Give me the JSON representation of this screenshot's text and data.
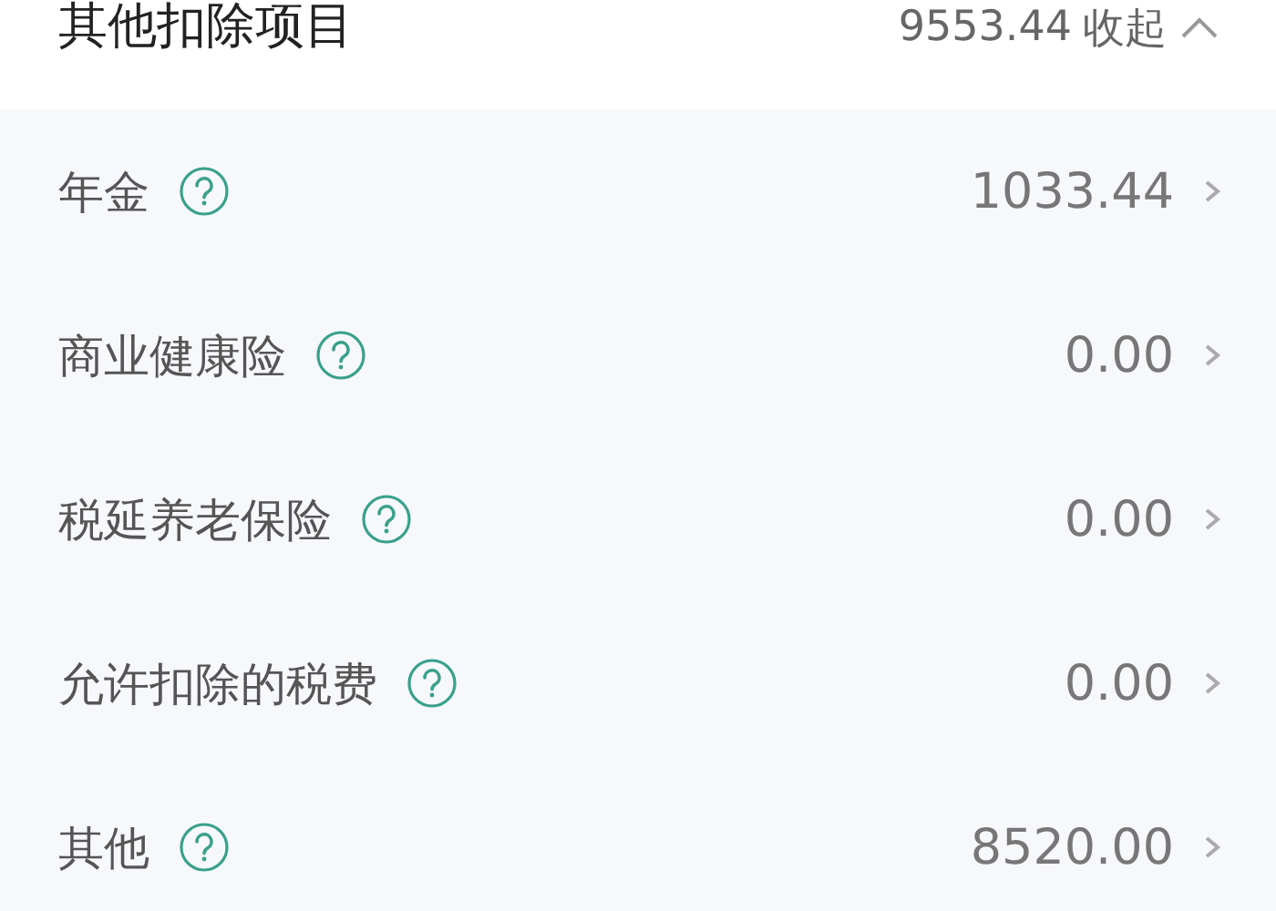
{
  "header": {
    "title": "其他扣除项目",
    "total": "9553.44",
    "toggle": "收起",
    "expanded": true
  },
  "items": [
    {
      "label": "年金",
      "value": "1033.44"
    },
    {
      "label": "商业健康险",
      "value": "0.00"
    },
    {
      "label": "税延养老保险",
      "value": "0.00"
    },
    {
      "label": "允许扣除的税费",
      "value": "0.00"
    },
    {
      "label": "其他",
      "value": "8520.00"
    }
  ]
}
